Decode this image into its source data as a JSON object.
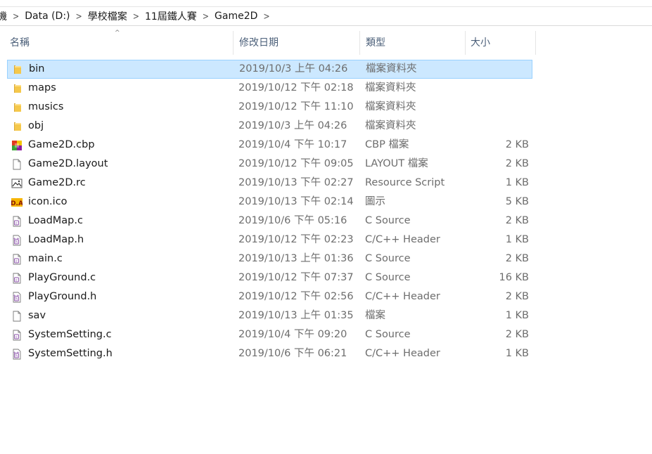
{
  "breadcrumb": {
    "items": [
      "機",
      "Data (D:)",
      "學校檔案",
      "11屆鐵人賽",
      "Game2D"
    ]
  },
  "columns": {
    "name": "名稱",
    "date": "修改日期",
    "type": "類型",
    "size": "大小"
  },
  "files": [
    {
      "name": "bin",
      "date": "2019/10/3 上午 04:26",
      "type": "檔案資料夾",
      "size": "",
      "icon": "folder-icon",
      "selected": true
    },
    {
      "name": "maps",
      "date": "2019/10/12 下午 02:18",
      "type": "檔案資料夾",
      "size": "",
      "icon": "folder-icon"
    },
    {
      "name": "musics",
      "date": "2019/10/12 下午 11:10",
      "type": "檔案資料夾",
      "size": "",
      "icon": "folder-icon"
    },
    {
      "name": "obj",
      "date": "2019/10/3 上午 04:26",
      "type": "檔案資料夾",
      "size": "",
      "icon": "folder-icon"
    },
    {
      "name": "Game2D.cbp",
      "date": "2019/10/4 下午 10:17",
      "type": "CBP 檔案",
      "size": "2 KB",
      "icon": "codeblocks-project-icon"
    },
    {
      "name": "Game2D.layout",
      "date": "2019/10/12 下午 09:05",
      "type": "LAYOUT 檔案",
      "size": "2 KB",
      "icon": "blank-file-icon"
    },
    {
      "name": "Game2D.rc",
      "date": "2019/10/13 下午 02:27",
      "type": "Resource Script",
      "size": "1 KB",
      "icon": "resource-script-icon"
    },
    {
      "name": "icon.ico",
      "date": "2019/10/13 下午 02:14",
      "type": "圖示",
      "size": "5 KB",
      "icon": "ico-image-icon"
    },
    {
      "name": "LoadMap.c",
      "date": "2019/10/6 下午 05:16",
      "type": "C Source",
      "size": "2 KB",
      "icon": "c-source-icon"
    },
    {
      "name": "LoadMap.h",
      "date": "2019/10/12 下午 02:23",
      "type": "C/C++ Header",
      "size": "1 KB",
      "icon": "c-header-icon"
    },
    {
      "name": "main.c",
      "date": "2019/10/13 上午 01:36",
      "type": "C Source",
      "size": "2 KB",
      "icon": "c-source-icon"
    },
    {
      "name": "PlayGround.c",
      "date": "2019/10/12 下午 07:37",
      "type": "C Source",
      "size": "16 KB",
      "icon": "c-source-icon"
    },
    {
      "name": "PlayGround.h",
      "date": "2019/10/12 下午 02:56",
      "type": "C/C++ Header",
      "size": "2 KB",
      "icon": "c-header-icon"
    },
    {
      "name": "sav",
      "date": "2019/10/13 上午 01:35",
      "type": "檔案",
      "size": "1 KB",
      "icon": "blank-file-icon"
    },
    {
      "name": "SystemSetting.c",
      "date": "2019/10/4 下午 09:20",
      "type": "C Source",
      "size": "2 KB",
      "icon": "c-source-icon"
    },
    {
      "name": "SystemSetting.h",
      "date": "2019/10/6 下午 06:21",
      "type": "C/C++ Header",
      "size": "1 KB",
      "icon": "c-header-icon"
    }
  ],
  "colors": {
    "selection_bg": "#cce8ff",
    "selection_border": "#99d1ff",
    "folder": "#f0c55a",
    "header_text": "#4c607a",
    "secondary_text": "#6d6d6d"
  }
}
